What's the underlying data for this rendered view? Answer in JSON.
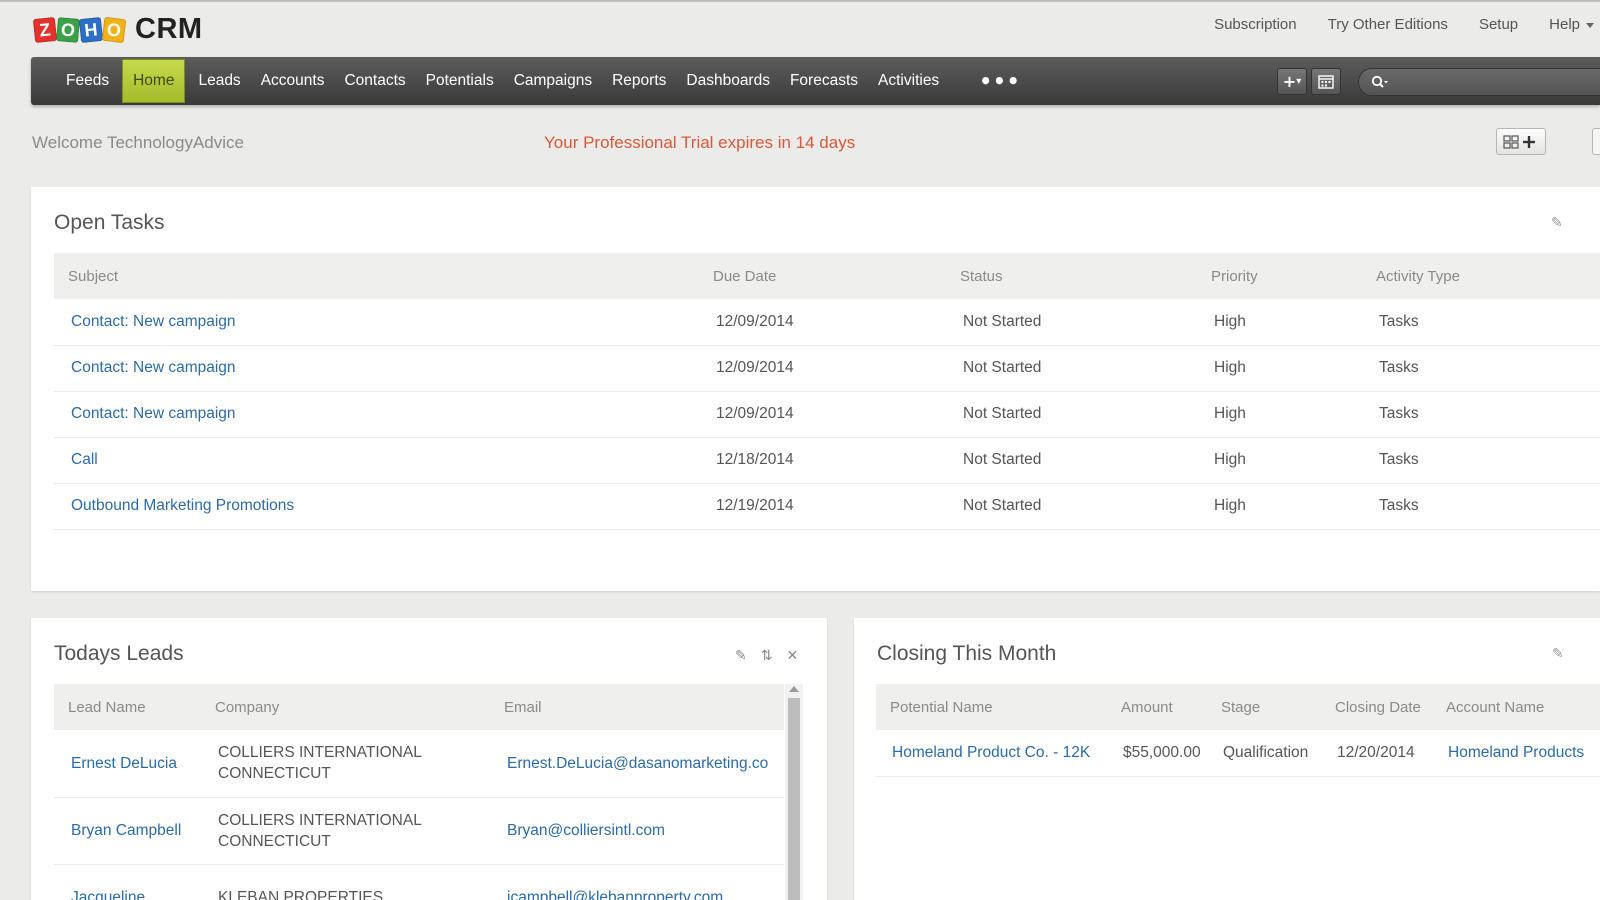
{
  "header": {
    "logo_letters": [
      "Z",
      "O",
      "H",
      "O"
    ],
    "logo_colors": [
      "#e4312b",
      "#3ba247",
      "#2d6fc4",
      "#f1b219"
    ],
    "app_name": "CRM",
    "links": [
      "Subscription",
      "Try Other Editions",
      "Setup",
      "Help"
    ]
  },
  "nav": {
    "items": [
      "Feeds",
      "Home",
      "Leads",
      "Accounts",
      "Contacts",
      "Potentials",
      "Campaigns",
      "Reports",
      "Dashboards",
      "Forecasts",
      "Activities"
    ],
    "active": "Home",
    "more": "•••",
    "active_color": "#b3c93a",
    "bar_color": "#474747"
  },
  "welcome": {
    "text": "Welcome TechnologyAdvice",
    "trial": "Your Professional Trial expires in 14 days",
    "trial_color": "#d9583a"
  },
  "open_tasks": {
    "title": "Open Tasks",
    "columns": [
      "Subject",
      "Due Date",
      "Status",
      "Priority",
      "Activity Type"
    ],
    "rows": [
      [
        "Contact: New campaign",
        "12/09/2014",
        "Not Started",
        "High",
        "Tasks"
      ],
      [
        "Contact: New campaign",
        "12/09/2014",
        "Not Started",
        "High",
        "Tasks"
      ],
      [
        "Contact: New campaign",
        "12/09/2014",
        "Not Started",
        "High",
        "Tasks"
      ],
      [
        "Call",
        "12/18/2014",
        "Not Started",
        "High",
        "Tasks"
      ],
      [
        "Outbound Marketing Promotions",
        "12/19/2014",
        "Not Started",
        "High",
        "Tasks"
      ]
    ]
  },
  "todays_leads": {
    "title": "Todays Leads",
    "columns": [
      "Lead Name",
      "Company",
      "Email"
    ],
    "rows": [
      [
        "Ernest DeLucia",
        "COLLIERS INTERNATIONAL CONNECTICUT",
        "Ernest.DeLucia@dasanomarketing.co"
      ],
      [
        "Bryan Campbell",
        "COLLIERS INTERNATIONAL CONNECTICUT",
        "Bryan@colliersintl.com"
      ],
      [
        "Jacqueline",
        "KLEBAN PROPERTIES",
        "jcampbell@klebanproperty.com"
      ]
    ]
  },
  "closing_this_month": {
    "title": "Closing This Month",
    "columns": [
      "Potential Name",
      "Amount",
      "Stage",
      "Closing Date",
      "Account Name"
    ],
    "rows": [
      [
        "Homeland Product Co. - 12K",
        "$55,000.00",
        "Qualification",
        "12/20/2014",
        "Homeland Products"
      ]
    ]
  },
  "icons": {
    "add": "plus-icon",
    "calendar": "calendar-icon",
    "search": "search-icon",
    "edit": "pencil-icon",
    "refresh": "refresh-icon",
    "close": "close-icon",
    "add_component": "grid-plus-icon"
  }
}
